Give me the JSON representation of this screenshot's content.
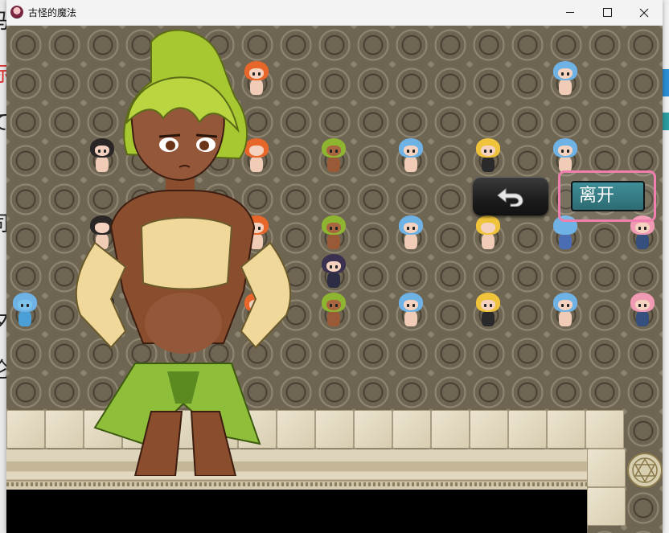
{
  "window": {
    "title": "古怪的魔法",
    "icons": {
      "app": "app-icon",
      "minimize": "minimize-icon",
      "maximize": "maximize-icon",
      "close": "close-icon"
    }
  },
  "colors": {
    "titlebar": "#f3f3f3",
    "floor_bg": "#6e6553",
    "leave_button_fill": "#3a7d86",
    "leave_button_frame": "#f07fb0",
    "back_button": "#1c1c1c",
    "heroine_hair": "#a8c832",
    "heroine_skin": "#8a4e2e",
    "heroine_outfit_top": "#f0d89a",
    "heroine_outfit_skirt": "#8fbf3a"
  },
  "buttons": {
    "leave_label": "离开",
    "back_icon": "undo-arrow-icon"
  },
  "desktop_edge_glyphs": [
    "马",
    "标",
    "て",
    "·",
    "司",
    "(",
    "夕",
    "沦"
  ],
  "characters": {
    "hair_colors": {
      "orange": "#e8662a",
      "blue": "#6fb2e6",
      "black": "#2b2626",
      "green": "#8db530",
      "blonde": "#f0c43a",
      "dark": "#3a3050",
      "pink": "#f19ab4"
    }
  }
}
